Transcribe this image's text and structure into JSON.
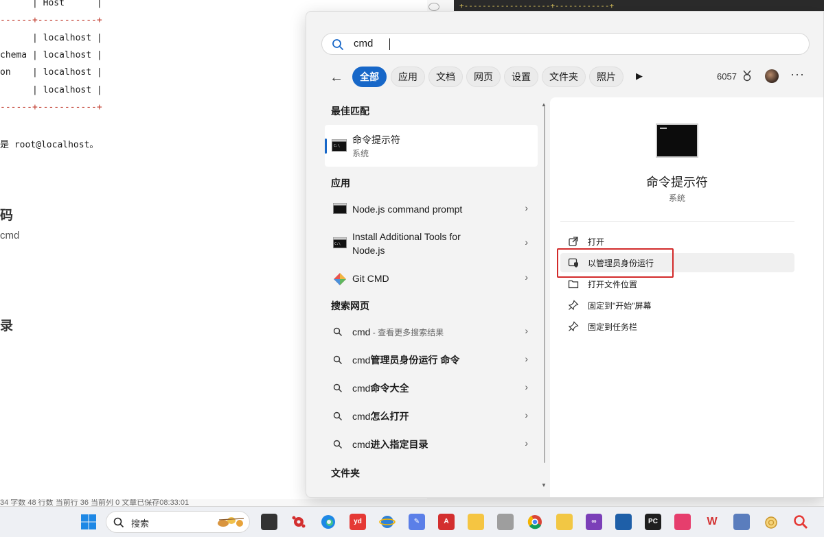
{
  "background_doc": {
    "table_lines": [
      "      | Host      |",
      "------+-----------+",
      "      | localhost |",
      "chema | localhost |",
      "on    | localhost |",
      "      | localhost |",
      "------+-----------+"
    ],
    "note": "是 root@localhost。",
    "heading1": "码",
    "cmd_text": "cmd",
    "heading2": "录",
    "status_bar": "34 字数 48 行数 当前行 36 当前列 0 文章已保存08:33:01",
    "right_pane_top": "+-------------------+------------+"
  },
  "search": {
    "query": "cmd",
    "filters": [
      "全部",
      "应用",
      "文档",
      "网页",
      "设置",
      "文件夹",
      "照片"
    ],
    "active_filter": "全部",
    "points": "6057"
  },
  "results": {
    "best_match_header": "最佳匹配",
    "best_match": {
      "title": "命令提示符",
      "subtitle": "系统"
    },
    "apps_header": "应用",
    "apps": [
      {
        "label": "Node.js command prompt"
      },
      {
        "label_line1": "Install Additional Tools for",
        "label_line2": "Node.js"
      },
      {
        "label": "Git CMD"
      }
    ],
    "web_header": "搜索网页",
    "web": [
      {
        "query": "cmd",
        "suffix": " - 查看更多搜索结果"
      },
      {
        "query": "cmd",
        "rest": "管理员身份运行 命令"
      },
      {
        "query": "cmd",
        "rest": "命令大全"
      },
      {
        "query": "cmd",
        "rest": "怎么打开"
      },
      {
        "query": "cmd",
        "rest": "进入指定目录"
      }
    ],
    "folders_header": "文件夹"
  },
  "preview": {
    "title": "命令提示符",
    "subtitle": "系统",
    "actions": [
      "打开",
      "以管理员身份运行",
      "打开文件位置",
      "固定到\"开始\"屏幕",
      "固定到任务栏"
    ]
  },
  "taskbar": {
    "search_label": "搜索",
    "apps": [
      "files",
      "gear-red",
      "edge",
      "youdao",
      "ie",
      "notes",
      "acrobat",
      "explorer",
      "db",
      "chrome",
      "kid",
      "vs",
      "bluetooth",
      "pycharm",
      "xmind",
      "wps",
      "network",
      "snail",
      "search-tool"
    ]
  },
  "colors": {
    "accent": "#1767c8",
    "highlight": "#d22a2a"
  }
}
